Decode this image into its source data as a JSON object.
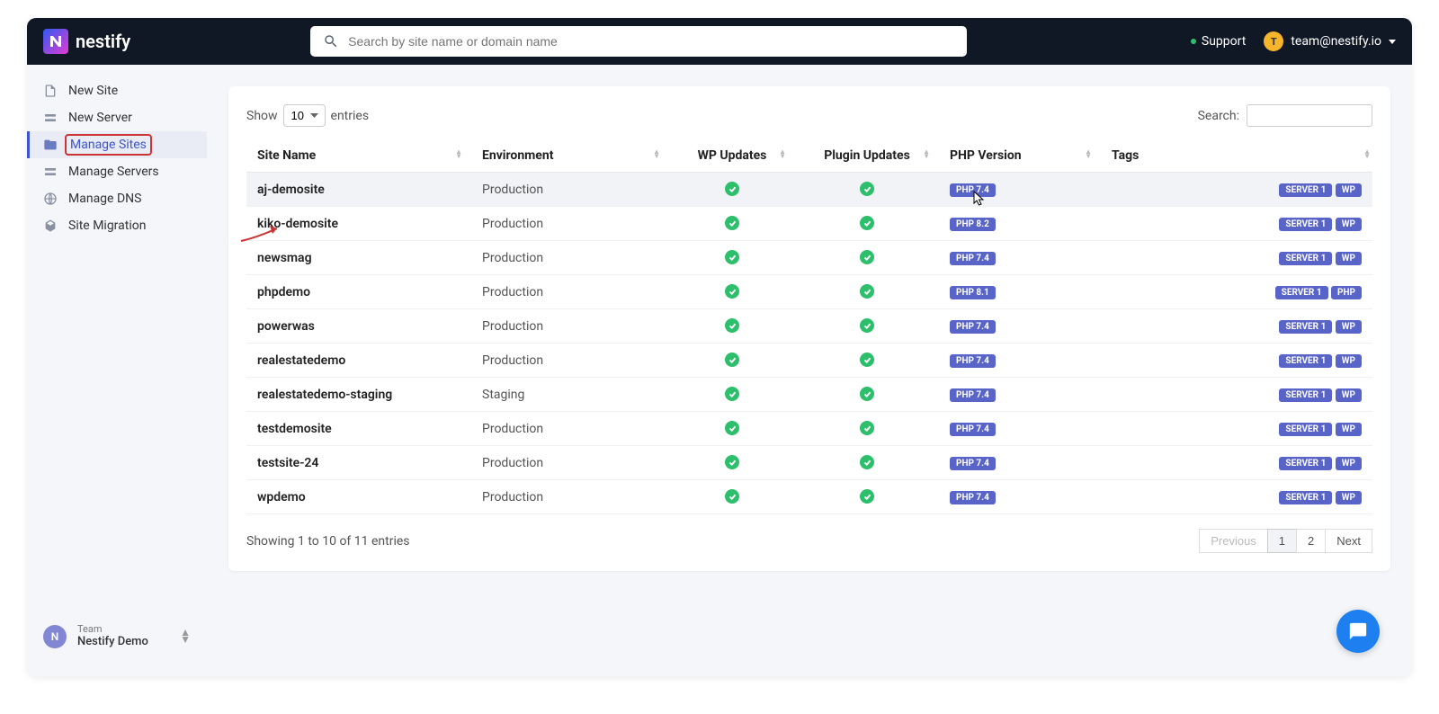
{
  "brand": "nestify",
  "search": {
    "placeholder": "Search by site name or domain name"
  },
  "topbar": {
    "support": "Support",
    "user_initial": "T",
    "user_email": "team@nestify.io"
  },
  "nav": {
    "items": [
      {
        "label": "New Site"
      },
      {
        "label": "New Server"
      },
      {
        "label": "Manage Sites"
      },
      {
        "label": "Manage Servers"
      },
      {
        "label": "Manage DNS"
      },
      {
        "label": "Site Migration"
      }
    ]
  },
  "team": {
    "label": "Team",
    "name": "Nestify Demo",
    "initial": "N"
  },
  "table": {
    "show_label": "Show",
    "entries_label": "entries",
    "entries_value": "10",
    "search_label": "Search:",
    "headers": {
      "site_name": "Site Name",
      "environment": "Environment",
      "wp_updates": "WP Updates",
      "plugin_updates": "Plugin Updates",
      "php_version": "PHP Version",
      "tags": "Tags"
    },
    "rows": [
      {
        "site": "aj-demosite",
        "env": "Production",
        "wp": true,
        "plugin": true,
        "php": "PHP 7.4",
        "tags": [
          "SERVER 1",
          "WP"
        ]
      },
      {
        "site": "kiko-demosite",
        "env": "Production",
        "wp": true,
        "plugin": true,
        "php": "PHP 8.2",
        "tags": [
          "SERVER 1",
          "WP"
        ]
      },
      {
        "site": "newsmag",
        "env": "Production",
        "wp": true,
        "plugin": true,
        "php": "PHP 7.4",
        "tags": [
          "SERVER 1",
          "WP"
        ]
      },
      {
        "site": "phpdemo",
        "env": "Production",
        "wp": true,
        "plugin": true,
        "php": "PHP 8.1",
        "tags": [
          "SERVER 1",
          "PHP"
        ]
      },
      {
        "site": "powerwas",
        "env": "Production",
        "wp": true,
        "plugin": true,
        "php": "PHP 7.4",
        "tags": [
          "SERVER 1",
          "WP"
        ]
      },
      {
        "site": "realestatedemo",
        "env": "Production",
        "wp": true,
        "plugin": true,
        "php": "PHP 7.4",
        "tags": [
          "SERVER 1",
          "WP"
        ]
      },
      {
        "site": "realestatedemo-staging",
        "env": "Staging",
        "wp": true,
        "plugin": true,
        "php": "PHP 7.4",
        "tags": [
          "SERVER 1",
          "WP"
        ]
      },
      {
        "site": "testdemosite",
        "env": "Production",
        "wp": true,
        "plugin": true,
        "php": "PHP 7.4",
        "tags": [
          "SERVER 1",
          "WP"
        ]
      },
      {
        "site": "testsite-24",
        "env": "Production",
        "wp": true,
        "plugin": true,
        "php": "PHP 7.4",
        "tags": [
          "SERVER 1",
          "WP"
        ]
      },
      {
        "site": "wpdemo",
        "env": "Production",
        "wp": true,
        "plugin": true,
        "php": "PHP 7.4",
        "tags": [
          "SERVER 1",
          "WP"
        ]
      }
    ],
    "footer_info": "Showing 1 to 10 of 11 entries",
    "pagination": {
      "prev": "Previous",
      "next": "Next",
      "pages": [
        "1",
        "2"
      ],
      "active": "1"
    }
  }
}
